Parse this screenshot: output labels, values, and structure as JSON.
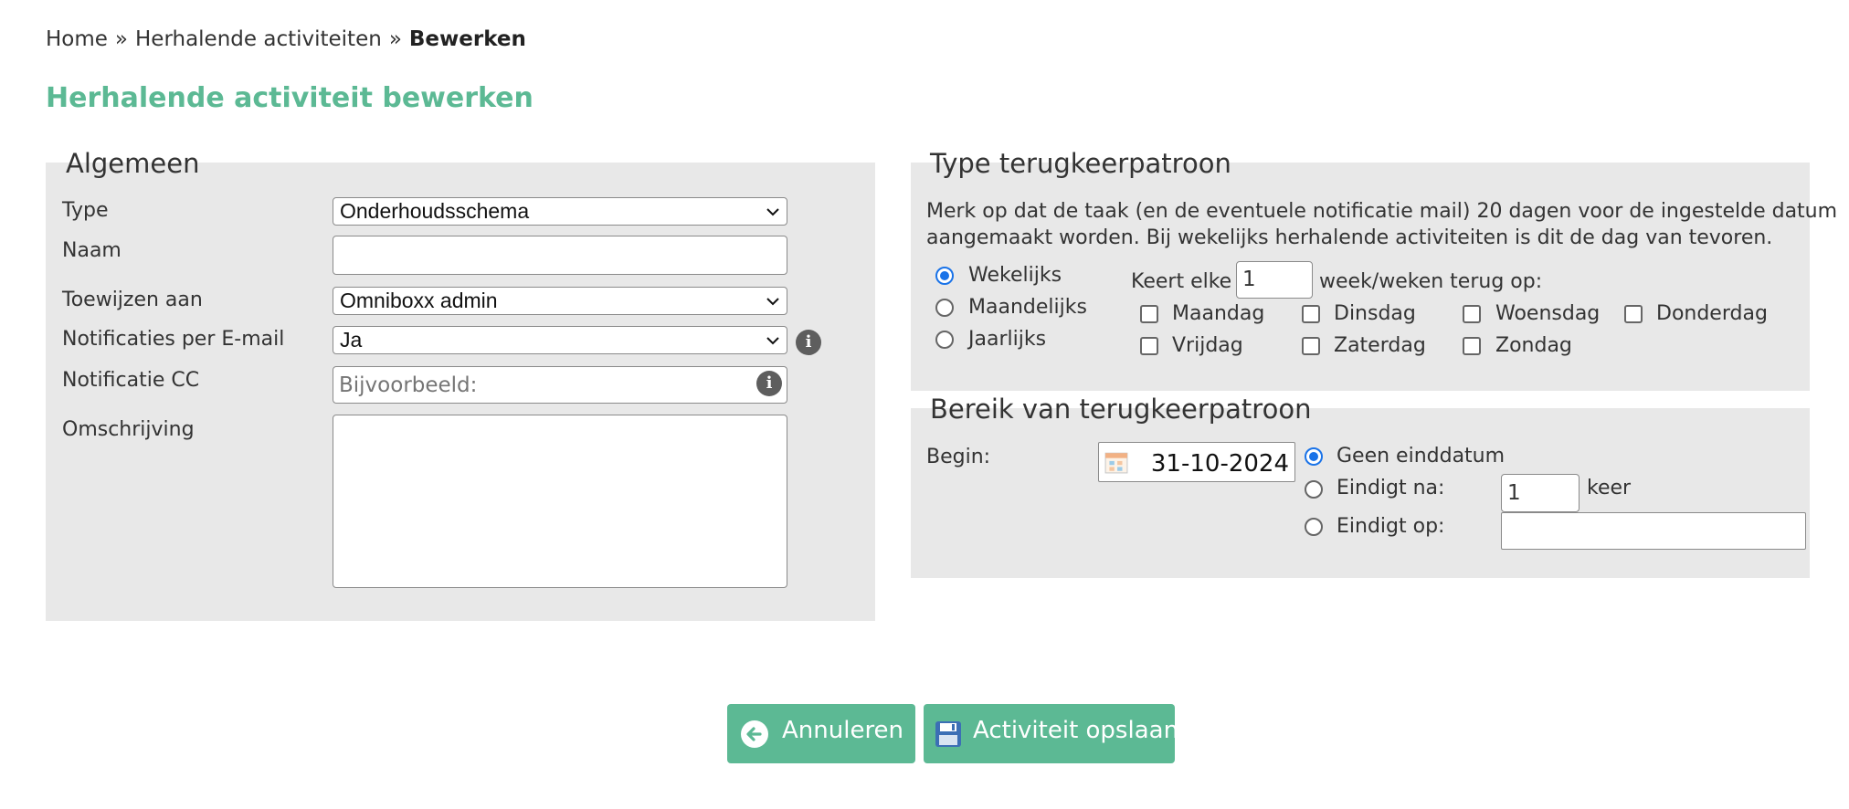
{
  "breadcrumb": {
    "items": [
      "Home",
      "Herhalende activiteiten"
    ],
    "separator": "»",
    "current": "Bewerken"
  },
  "page_title": "Herhalende activiteit bewerken",
  "general": {
    "legend": "Algemeen",
    "type_label": "Type",
    "type_value": "Onderhoudsschema",
    "name_label": "Naam",
    "name_value": "",
    "assign_label": "Toewijzen aan",
    "assign_value": "Omniboxx admin",
    "notif_label": "Notificaties per E-mail",
    "notif_value": "Ja",
    "cc_label": "Notificatie CC",
    "cc_placeholder": "Bijvoorbeeld:",
    "desc_label": "Omschrijving",
    "desc_value": ""
  },
  "pattern": {
    "legend": "Type terugkeerpatroon",
    "note_line1": "Merk op dat de taak (en de eventuele notificatie mail) 20 dagen voor de ingestelde datum",
    "note_line2": "aangemaakt worden. Bij wekelijks herhalende activiteiten is dit de dag van tevoren.",
    "options": [
      "Wekelijks",
      "Maandelijks",
      "Jaarlijks"
    ],
    "selected": "Wekelijks",
    "recur_prefix": "Keert elke",
    "recur_value": "1",
    "recur_suffix": "week/weken terug op:",
    "days": [
      "Maandag",
      "Dinsdag",
      "Woensdag",
      "Donderdag",
      "Vrijdag",
      "Zaterdag",
      "Zondag"
    ]
  },
  "range": {
    "legend": "Bereik van terugkeerpatroon",
    "begin_label": "Begin:",
    "begin_value": "31-10-2024",
    "no_end_label": "Geen einddatum",
    "end_after_label": "Eindigt na:",
    "end_after_value": "1",
    "end_after_unit": "keer",
    "end_on_label": "Eindigt op:",
    "end_on_value": "",
    "selected": "Geen einddatum"
  },
  "buttons": {
    "cancel": "Annuleren",
    "save": "Activiteit opslaan"
  },
  "colors": {
    "accent": "#5cb994",
    "panel": "#e8e8e8",
    "radio_selected": "#1a73e8"
  },
  "icons": {
    "info": "info-icon",
    "cancel": "arrow-left-circle-icon",
    "save": "floppy-disk-icon",
    "calendar": "calendar-icon",
    "chevron": "chevron-down-icon"
  }
}
